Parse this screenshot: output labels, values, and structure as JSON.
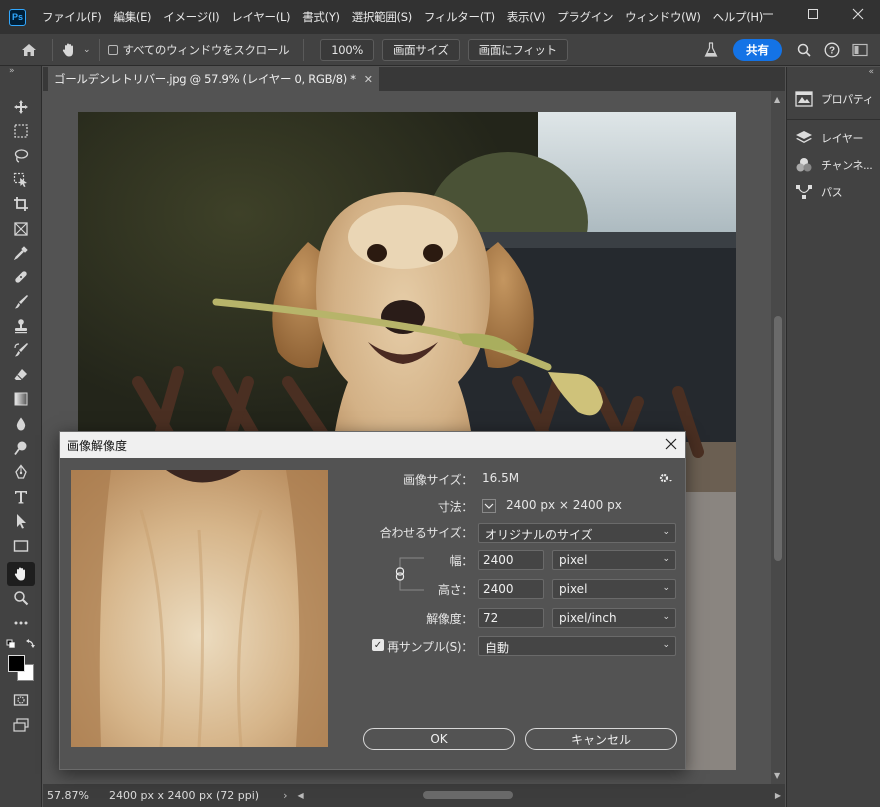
{
  "app": {
    "logo": "Ps",
    "menu": [
      "ファイル(F)",
      "編集(E)",
      "イメージ(I)",
      "レイヤー(L)",
      "書式(Y)",
      "選択範囲(S)",
      "フィルター(T)",
      "表示(V)",
      "プラグイン",
      "ウィンドウ(W)",
      "ヘルプ(H)"
    ],
    "window_controls": [
      "minimize",
      "maximize",
      "close"
    ]
  },
  "options_bar": {
    "scroll_all_label": "すべてのウィンドウをスクロール",
    "zoom_100": "100%",
    "screen_size": "画面サイズ",
    "fit_screen": "画面にフィット",
    "share": "共有"
  },
  "document": {
    "tab_title": "ゴールデンレトリバー.jpg @ 57.9% (レイヤー 0, RGB/8) *",
    "zoom": "57.87%",
    "status_info": "2400 px x 2400 px (72 ppi)"
  },
  "panels": {
    "properties": "プロパティ",
    "layers": "レイヤー",
    "channels": "チャンネ...",
    "paths": "パス"
  },
  "dialog": {
    "title": "画像解像度",
    "image_size_label": "画像サイズ：",
    "image_size_value": "16.5M",
    "dimensions_label": "寸法：",
    "dimensions_value": "2400 px × 2400 px",
    "fit_to_label": "合わせるサイズ：",
    "fit_to_value": "オリジナルのサイズ",
    "width_label": "幅：",
    "width_value": "2400",
    "width_unit": "pixel",
    "height_label": "高さ：",
    "height_value": "2400",
    "height_unit": "pixel",
    "resolution_label": "解像度：",
    "resolution_value": "72",
    "resolution_unit": "pixel/inch",
    "resample_label": "再サンプル(S)：",
    "resample_checked": true,
    "resample_value": "自動",
    "ok": "OK",
    "cancel": "キャンセル"
  },
  "colors": {
    "accent": "#1473e6",
    "ui_dark": "#323232",
    "ui_panel": "#424242",
    "ui_canvas": "#535353"
  }
}
